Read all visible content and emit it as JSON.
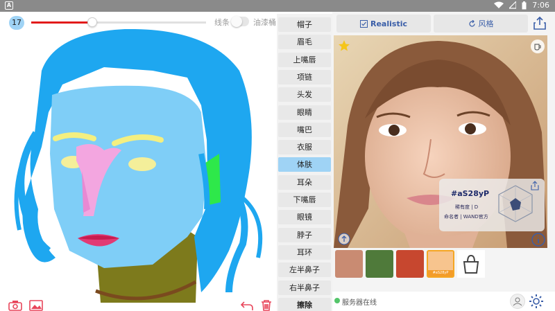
{
  "status_bar": {
    "time": "7:06",
    "left_icon": "A"
  },
  "brush": {
    "size": "17",
    "slider_value": 0.35,
    "accent": "#e21b1b"
  },
  "mode": {
    "line_label": "线条",
    "fill_label": "油漆桶"
  },
  "categories": [
    {
      "label": "帽子",
      "selected": false
    },
    {
      "label": "眉毛",
      "selected": false
    },
    {
      "label": "上嘴唇",
      "selected": false
    },
    {
      "label": "项链",
      "selected": false
    },
    {
      "label": "头发",
      "selected": false
    },
    {
      "label": "眼睛",
      "selected": false
    },
    {
      "label": "嘴巴",
      "selected": false
    },
    {
      "label": "衣服",
      "selected": false
    },
    {
      "label": "体肤",
      "selected": true
    },
    {
      "label": "耳朵",
      "selected": false
    },
    {
      "label": "下嘴唇",
      "selected": false
    },
    {
      "label": "眼镜",
      "selected": false
    },
    {
      "label": "脖子",
      "selected": false
    },
    {
      "label": "耳环",
      "selected": false
    },
    {
      "label": "左半鼻子",
      "selected": false
    },
    {
      "label": "右半鼻子",
      "selected": false
    },
    {
      "label": "擦除",
      "selected": false
    }
  ],
  "toolbar": {
    "realistic_label": "Realistic",
    "style_label": "风格"
  },
  "result_card": {
    "name": "#aS28yP",
    "rarity": "稀有度 | D",
    "author": "命名者 | WAND官方"
  },
  "thumbnails": [
    {
      "name": "texture-1",
      "color": "#c98b72"
    },
    {
      "name": "texture-2",
      "color": "#4f7a3a"
    },
    {
      "name": "texture-3",
      "color": "#c7472f"
    },
    {
      "name": "texture-4",
      "color": "#f7c48e",
      "caption": "#aS28yP"
    }
  ],
  "footer": {
    "server_status": "服务器在线",
    "status_color": "#54c56a"
  },
  "colors": {
    "selected_category": "#9fd3f5",
    "link_blue": "#3a5ea8",
    "hair": "#1ea7f0",
    "skin": "#7fcef7"
  },
  "icons": [
    "camera-icon",
    "image-icon",
    "undo-icon",
    "trash-icon",
    "share-icon",
    "star-icon",
    "cup-icon",
    "upload-icon",
    "info-icon",
    "user-icon",
    "gear-icon"
  ]
}
